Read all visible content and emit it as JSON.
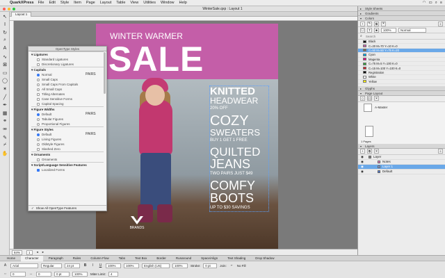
{
  "menubar": {
    "app": "QuarkXPress",
    "items": [
      "File",
      "Edit",
      "Style",
      "Item",
      "Page",
      "Layout",
      "Table",
      "View",
      "Utilities",
      "Window",
      "Help"
    ],
    "status_icons": [
      "wifi-icon",
      "battery-icon",
      "search-icon",
      "menu-icon"
    ]
  },
  "window": {
    "title": "WinterSale.qxp : Layout 1",
    "tab": "Layout 1"
  },
  "poster": {
    "heading": "WINTER WARMER",
    "big": "SALE",
    "lines": [
      {
        "text": "KNITTED",
        "size": "big"
      },
      {
        "text": "HEADWEAR",
        "size": "big"
      },
      {
        "text": "20% OFF",
        "size": "small"
      },
      {
        "text": "COZY",
        "size": "huge"
      },
      {
        "text": "SWEATERS",
        "size": "big"
      },
      {
        "text": "BUY 1 GET 1 FREE",
        "size": "small"
      },
      {
        "text": "QUILTED",
        "size": "huge"
      },
      {
        "text": "JEANS",
        "size": "huge"
      },
      {
        "text": "TWO PAIRS JUST $49",
        "size": "small"
      },
      {
        "text": "COMFY",
        "size": "huge"
      },
      {
        "text": "BOOTS",
        "size": "huge"
      },
      {
        "text": "UP TO $30 SAVINGS",
        "size": "small"
      }
    ],
    "brand": "BRANDS",
    "colors": {
      "band": "#c45ea8",
      "text": "#ffffff",
      "highlight": "#c45ea8"
    }
  },
  "opentype_panel": {
    "title": "OpenType Styles",
    "sections": [
      {
        "name": "Ligatures",
        "items": [
          {
            "label": "Standard Ligatures",
            "type": "check",
            "on": false
          },
          {
            "label": "Discretionary Ligatures",
            "type": "check",
            "on": false
          }
        ]
      },
      {
        "name": "Capitals",
        "items": [
          {
            "label": "Normal",
            "type": "radio",
            "on": true,
            "example": "PAIRS"
          },
          {
            "label": "Small Caps",
            "type": "radio",
            "on": false
          },
          {
            "label": "Small Caps From Capitals",
            "type": "radio",
            "on": false
          },
          {
            "label": "All Small Caps",
            "type": "radio",
            "on": false
          },
          {
            "label": "Titling Alternates",
            "type": "check",
            "on": false
          },
          {
            "label": "Case Sensitive Forms",
            "type": "check",
            "on": false
          },
          {
            "label": "Capital Spacing",
            "type": "check",
            "on": false
          }
        ]
      },
      {
        "name": "Figure Widths",
        "items": [
          {
            "label": "Default",
            "type": "radio",
            "on": true,
            "example": "PAIRS"
          },
          {
            "label": "Tabular Figures",
            "type": "radio",
            "on": false
          },
          {
            "label": "Proportional Figures",
            "type": "radio",
            "on": false
          }
        ]
      },
      {
        "name": "Figure Styles",
        "items": [
          {
            "label": "Default",
            "type": "radio",
            "on": true,
            "example": "PAIRS"
          },
          {
            "label": "Lining Figures",
            "type": "radio",
            "on": false
          },
          {
            "label": "Oldstyle Figures",
            "type": "radio",
            "on": false
          },
          {
            "label": "Slashed Zero",
            "type": "check",
            "on": false
          }
        ]
      },
      {
        "name": "Ornaments",
        "items": [
          {
            "label": "Ornaments",
            "type": "check",
            "on": false
          }
        ]
      },
      {
        "name": "Script/Language Sensitive Features",
        "items": [
          {
            "label": "Localized Forms",
            "type": "check",
            "on": true
          }
        ]
      }
    ],
    "footer": "Show All OpenType Features"
  },
  "right_panel": {
    "style_sheets": "Style Sheets",
    "gradients": "Gradients",
    "colors_title": "Colors",
    "tint": "100%",
    "blend": "Normal",
    "search_placeholder": "Search",
    "colors": [
      {
        "name": "Black",
        "hex": "#000000",
        "sel": false
      },
      {
        "name": "C=20 M=70 Y=10 K=0",
        "hex": "#c45ea8",
        "sel": false
      },
      {
        "name": "C=50 M=50 Y=75 K=20",
        "hex": "#7a6a4a",
        "sel": true
      },
      {
        "name": "Cyan",
        "hex": "#00a8e8",
        "sel": false
      },
      {
        "name": "Magenta",
        "hex": "#e6007e",
        "sel": false
      },
      {
        "name": "C=75 M=5 Y=100 K=0",
        "hex": "#2fa33a",
        "sel": false
      },
      {
        "name": "C=15 M=100 Y=100 K=0",
        "hex": "#d21f26",
        "sel": false
      },
      {
        "name": "Registration",
        "hex": "#000000",
        "sel": false
      },
      {
        "name": "White",
        "hex": "#ffffff",
        "sel": false
      },
      {
        "name": "Yellow",
        "hex": "#fff200",
        "sel": false
      }
    ],
    "glyphs": "Glyphs",
    "page_layout": "Page Layout",
    "master": "A-Master",
    "pages_label": "1 Pages",
    "layers_title": "Layers",
    "layers": [
      {
        "name": "Layer",
        "indent": false,
        "sel": false,
        "color": "#888888"
      },
      {
        "name": "Notes",
        "indent": true,
        "sel": false,
        "color": "#e97ac1"
      },
      {
        "name": "Layer 1",
        "indent": true,
        "sel": true,
        "color": "#7a9ce6"
      },
      {
        "name": "Default",
        "indent": true,
        "sel": false,
        "color": "#4f7ad6"
      }
    ]
  },
  "statusbar": {
    "zoom": "84%",
    "page": "1"
  },
  "measurements": {
    "tabs": [
      "Home",
      "Character",
      "Paragraph",
      "Rules",
      "Column Flow",
      "Tabs",
      "Text Box",
      "Border",
      "Runaround",
      "Space/Align",
      "Text Shading",
      "Drop Shadow"
    ],
    "active_tab": "Character",
    "font": "Arial",
    "style": "Regular",
    "size": "24 pt",
    "scale_h": "100%",
    "scale_v": "100%",
    "kern": "0",
    "track": "0",
    "language": "English (US)",
    "shade": "100%",
    "opacity": "100%",
    "baseline": "0 pt",
    "stroke_label": "Stroke:",
    "stroke_value": "0 pt",
    "join_label": "Join:",
    "miter_label": "Miter Limit:",
    "miter_value": "4",
    "fill_label": "No Fill"
  }
}
